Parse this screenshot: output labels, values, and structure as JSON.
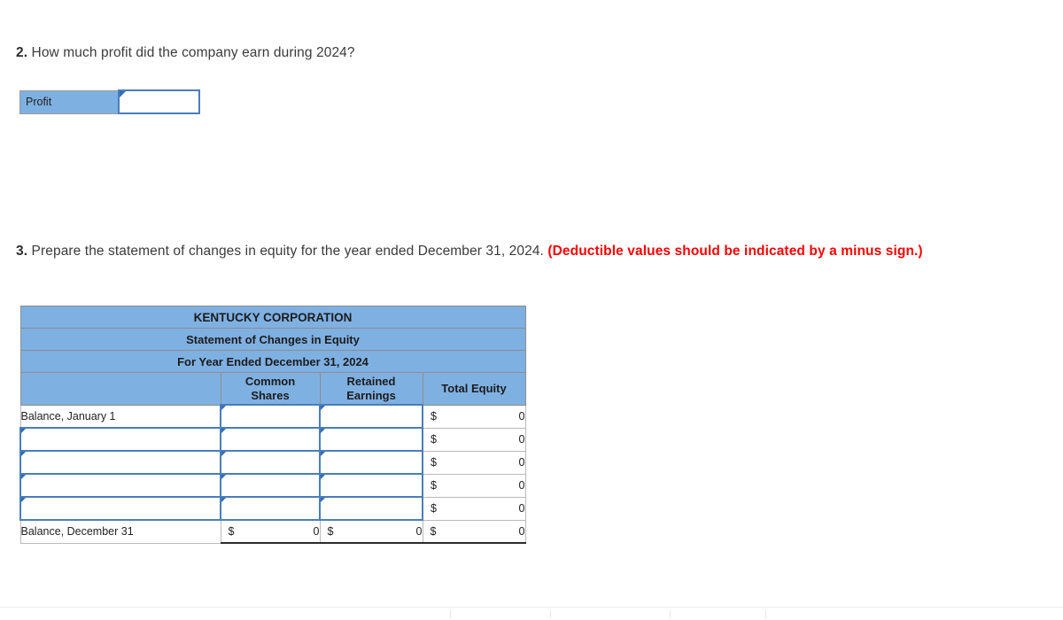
{
  "questions": [
    {
      "number": "2.",
      "text": " How much profit did the company earn during 2024?"
    },
    {
      "number": "3.",
      "text": " Prepare the statement of changes in equity for the year ended December 31, 2024. ",
      "emphasis": "(Deductible values should be indicated by a minus sign.)"
    }
  ],
  "profit_table": {
    "label": "Profit",
    "input_value": "",
    "input_placeholder": ""
  },
  "statement_table": {
    "titles": [
      "KENTUCKY CORPORATION",
      "Statement of Changes in Equity",
      "For Year Ended December 31, 2024"
    ],
    "column_headers": {
      "label": "",
      "common_shares": "Common Shares",
      "common_shares_line1": "Common",
      "common_shares_line2": "Shares",
      "retained_earnings": "Retained Earnings",
      "retained_earnings_line1": "Retained",
      "retained_earnings_line2": "Earnings",
      "total_equity": "Total Equity"
    },
    "rows": [
      {
        "label": "Balance, January 1",
        "label_editable": false,
        "common_shares": "",
        "retained_earnings": "",
        "total_currency": "$",
        "total_value": "0"
      },
      {
        "label": "",
        "label_editable": true,
        "common_shares": "",
        "retained_earnings": "",
        "total_currency": "$",
        "total_value": "0"
      },
      {
        "label": "",
        "label_editable": true,
        "common_shares": "",
        "retained_earnings": "",
        "total_currency": "$",
        "total_value": "0"
      },
      {
        "label": "",
        "label_editable": true,
        "common_shares": "",
        "retained_earnings": "",
        "total_currency": "$",
        "total_value": "0"
      },
      {
        "label": "",
        "label_editable": true,
        "common_shares": "",
        "retained_earnings": "",
        "total_currency": "$",
        "total_value": "0"
      }
    ],
    "total_row": {
      "label": "Balance, December 31",
      "common_currency": "$",
      "common_value": "0",
      "retained_currency": "$",
      "retained_value": "0",
      "total_currency": "$",
      "total_value": "0"
    }
  },
  "colors": {
    "header_blue": "#7fb0e2",
    "input_border_blue": "#4a7ebb",
    "emphasis_red": "#ff0000",
    "text_gray": "#3b3b3b",
    "grid_gray": "#b9b9b9"
  }
}
